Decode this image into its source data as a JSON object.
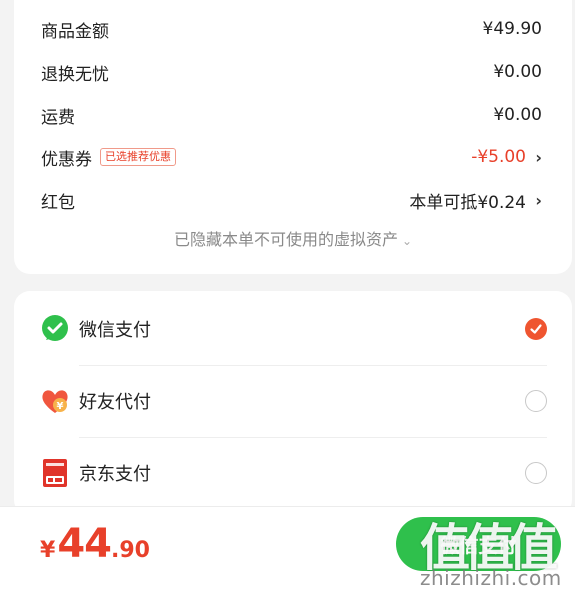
{
  "summary": {
    "rows": [
      {
        "label": "商品金额",
        "value": "¥49.90"
      },
      {
        "label": "退换无忧",
        "value": "¥0.00"
      },
      {
        "label": "运费",
        "value": "¥0.00"
      },
      {
        "label": "优惠券",
        "tag": "已选推荐优惠",
        "value": "-¥5.00"
      },
      {
        "label": "红包",
        "value": "本单可抵¥0.24"
      }
    ],
    "hidden_assets": "已隐藏本单不可使用的虚拟资产",
    "chevron": "›",
    "expand": "⌄"
  },
  "payment": {
    "methods": [
      {
        "label": "微信支付",
        "icon": "wechat-pay-icon",
        "selected": true
      },
      {
        "label": "好友代付",
        "icon": "friend-pay-heart-icon",
        "selected": false
      },
      {
        "label": "京东支付",
        "icon": "jd-pay-icon",
        "selected": false
      }
    ]
  },
  "bottom": {
    "total_symbol": "¥",
    "total_int": "44",
    "total_dec": ".90",
    "pay_button": "微信支付"
  },
  "watermark": {
    "logo": "值值值",
    "url": "zhizhizhi.com"
  },
  "colors": {
    "accent": "#e8402a",
    "wechat_green": "#2fc04c",
    "radio_selected": "#ef5530"
  }
}
